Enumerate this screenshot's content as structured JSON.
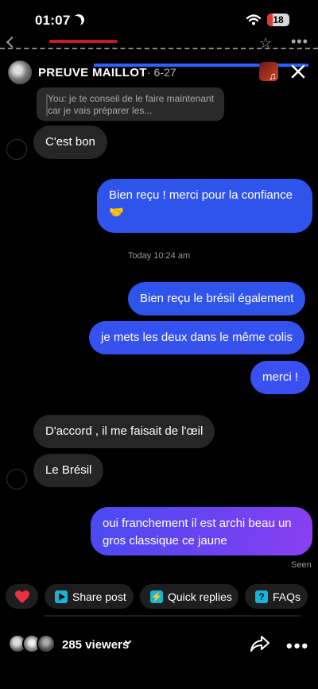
{
  "status": {
    "time": "01:07",
    "battery": "18"
  },
  "header": {
    "title": "PREUVE MAILLOT",
    "date": "· 6-27"
  },
  "reply_preview": {
    "text": "You: je te conseil de le faire maintenant car je vais préparer les..."
  },
  "messages": [
    {
      "dir": "in",
      "text": "C'est bon"
    },
    {
      "dir": "out",
      "text": "Bien reçu ! merci pour la confiance 🤝"
    },
    {
      "dir": "out",
      "text": "Bien reçu le brésil également"
    },
    {
      "dir": "out",
      "text": "je mets les deux dans le même colis"
    },
    {
      "dir": "out",
      "text": "merci !"
    },
    {
      "dir": "in",
      "text": "D'accord , il me faisait de l'œil"
    },
    {
      "dir": "in",
      "text": "Le Brésil"
    },
    {
      "dir": "out",
      "text": "oui franchement il est archi beau un gros classique ce jaune"
    }
  ],
  "timestamp": "Today 10:24 am",
  "seen": "Seen",
  "quick_actions": {
    "share": "Share post",
    "quick": "Quick replies",
    "faqs": "FAQs"
  },
  "footer": {
    "viewers": "285 viewers"
  },
  "colors": {
    "accent_blue": "#2f54eb",
    "purple": "#8a3ff0",
    "chip_icon": "#1ab3d8",
    "heart": "#e8323f"
  },
  "icons": [
    "moon-icon",
    "wifi-icon",
    "back-icon",
    "star-icon",
    "music-icon",
    "close-icon",
    "heart-icon",
    "play-icon",
    "lightning-icon",
    "question-icon",
    "share-icon",
    "more-icon",
    "chevron-down-icon"
  ]
}
